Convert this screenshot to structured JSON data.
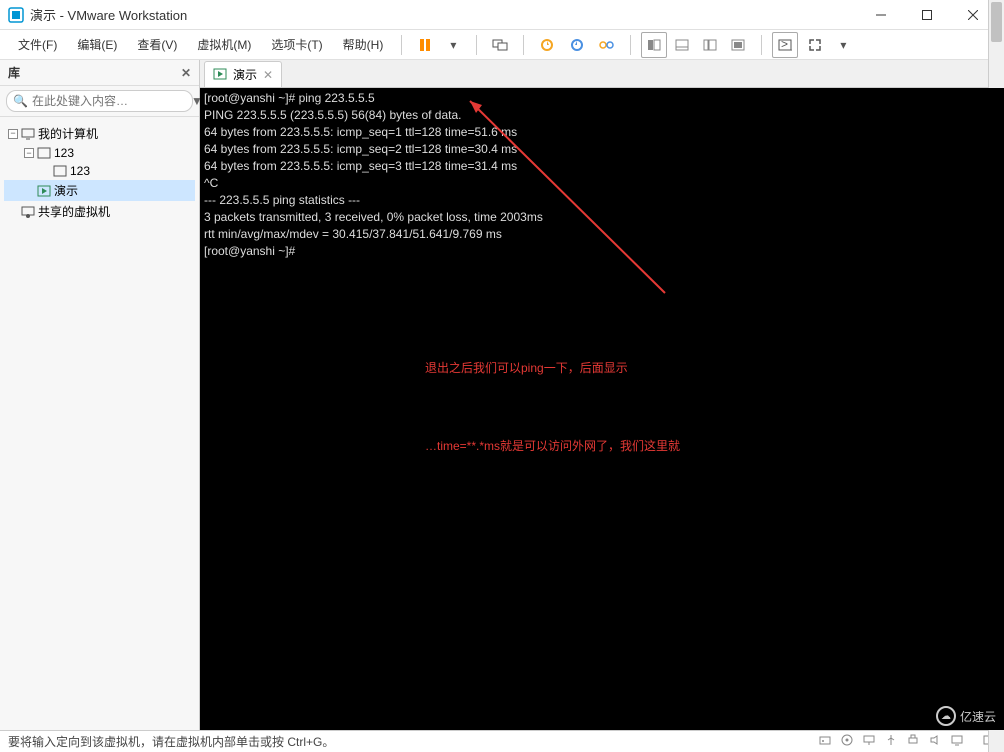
{
  "window": {
    "title": "演示 - VMware Workstation"
  },
  "menubar": {
    "file": "文件(F)",
    "edit": "编辑(E)",
    "view": "查看(V)",
    "vm": "虚拟机(M)",
    "tabs": "选项卡(T)",
    "help": "帮助(H)"
  },
  "sidebar": {
    "header": "库",
    "search_placeholder": "在此处键入内容…",
    "tree": {
      "root": "我的计算机",
      "node1": "123",
      "node1_child": "123",
      "demo": "演示",
      "shared": "共享的虚拟机"
    }
  },
  "tab": {
    "label": "演示"
  },
  "terminal": {
    "l1": "[root@yanshi ~]# ping 223.5.5.5",
    "l2": "PING 223.5.5.5 (223.5.5.5) 56(84) bytes of data.",
    "l3": "64 bytes from 223.5.5.5: icmp_seq=1 ttl=128 time=51.6 ms",
    "l4": "64 bytes from 223.5.5.5: icmp_seq=2 ttl=128 time=30.4 ms",
    "l5": "64 bytes from 223.5.5.5: icmp_seq=3 ttl=128 time=31.4 ms",
    "l6": "^C",
    "l7": "--- 223.5.5.5 ping statistics ---",
    "l8": "3 packets transmitted, 3 received, 0% packet loss, time 2003ms",
    "l9": "rtt min/avg/max/mdev = 30.415/37.841/51.641/9.769 ms",
    "l10": "[root@yanshi ~]# "
  },
  "annotation": {
    "line1": "退出之后我们可以ping一下，后面显示",
    "line2": "…time=**.*ms就是可以访问外网了，我们这里就"
  },
  "statusbar": {
    "text": "要将输入定向到该虚拟机，请在虚拟机内部单击或按 Ctrl+G。"
  },
  "watermark": {
    "text": "亿速云"
  }
}
